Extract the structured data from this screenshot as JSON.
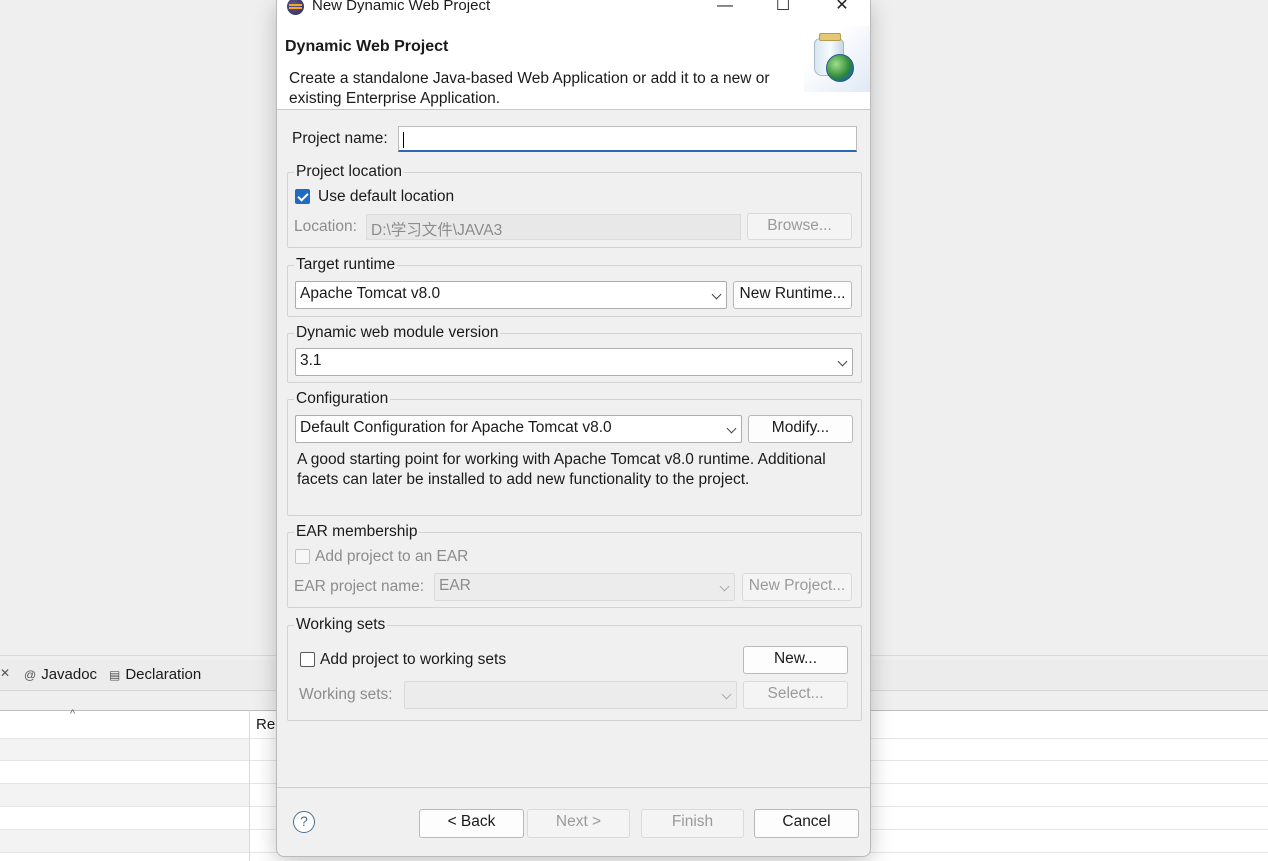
{
  "ide": {
    "tabs": [
      {
        "label": "Javadoc",
        "icon": "at-sign-icon"
      },
      {
        "label": "Declaration",
        "icon": "declaration-icon"
      }
    ],
    "table_header_partial": "Re"
  },
  "dialog": {
    "title": "New Dynamic Web Project",
    "window_controls": {
      "minimize": "—",
      "maximize": "☐",
      "close": "✕"
    },
    "banner": {
      "title": "Dynamic Web Project",
      "description": "Create a standalone Java-based Web Application or add it to a new or existing Enterprise Application."
    },
    "project_name": {
      "label": "Project name:",
      "value": ""
    },
    "project_location": {
      "title": "Project location",
      "use_default_label": "Use default location",
      "use_default_checked": true,
      "location_label": "Location:",
      "location_value": "D:\\学习文件\\JAVA3",
      "browse_label": "Browse..."
    },
    "target_runtime": {
      "title": "Target runtime",
      "selected": "Apache Tomcat v8.0",
      "new_runtime_label": "New Runtime..."
    },
    "web_module": {
      "title": "Dynamic web module version",
      "selected": "3.1"
    },
    "configuration": {
      "title": "Configuration",
      "selected": "Default Configuration for Apache Tomcat v8.0",
      "modify_label": "Modify...",
      "description": "A good starting point for working with Apache Tomcat v8.0 runtime. Additional facets can later be installed to add new functionality to the project."
    },
    "ear": {
      "title": "EAR membership",
      "add_label": "Add project to an EAR",
      "add_checked": false,
      "name_label": "EAR project name:",
      "name_value": "EAR",
      "new_project_label": "New Project..."
    },
    "working_sets": {
      "title": "Working sets",
      "add_label": "Add project to working sets",
      "add_checked": false,
      "new_label": "New...",
      "sets_label": "Working sets:",
      "sets_value": "",
      "select_label": "Select..."
    },
    "footer": {
      "help": "?",
      "back": "< Back",
      "next": "Next >",
      "finish": "Finish",
      "cancel": "Cancel"
    }
  }
}
